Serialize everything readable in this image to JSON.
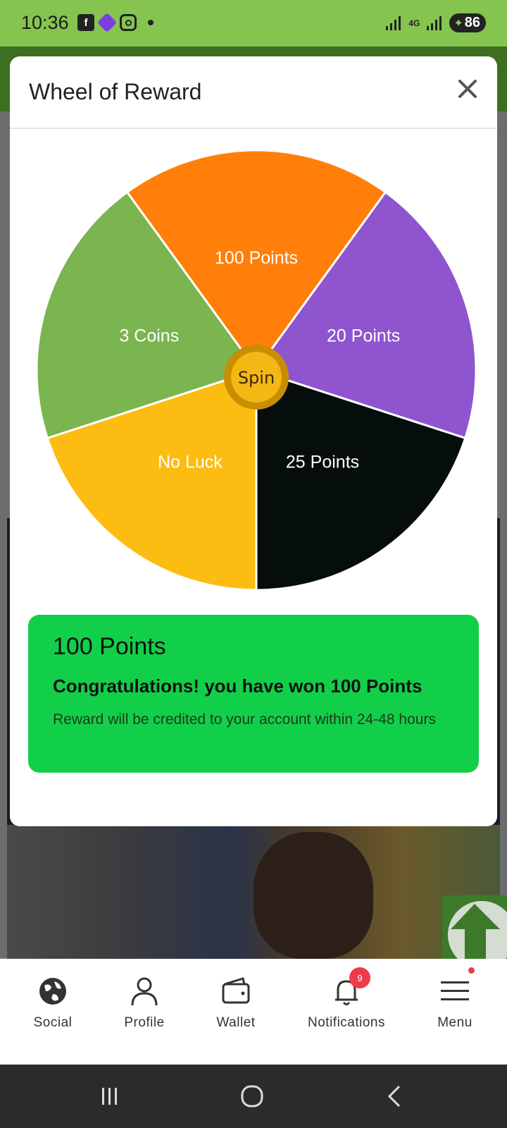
{
  "status_bar": {
    "time": "10:36",
    "network": "4G",
    "battery": "86",
    "notification_icons": [
      "facebook-icon",
      "app-icon",
      "instagram-icon"
    ]
  },
  "dialog": {
    "title": "Wheel of Reward",
    "close_icon": "close-icon",
    "spin_label": "Spin",
    "wheel_segments": [
      {
        "label": "100 Points",
        "color": "#FF7F0A"
      },
      {
        "label": "20 Points",
        "color": "#8F55CF"
      },
      {
        "label": "25 Points",
        "color": "#060D0D"
      },
      {
        "label": "No Luck",
        "color": "#FDBC12"
      },
      {
        "label": "3 Coins",
        "color": "#7AB54F"
      }
    ],
    "result": {
      "title": "100 Points",
      "message": "Congratulations! you have won 100 Points",
      "note": "Reward will be credited to your account within 24-48 hours",
      "color": "#12CF49"
    }
  },
  "bottom_nav": {
    "items": [
      {
        "label": "Social",
        "icon": "globe-icon"
      },
      {
        "label": "Profile",
        "icon": "user-icon"
      },
      {
        "label": "Wallet",
        "icon": "wallet-icon"
      },
      {
        "label": "Notifications",
        "icon": "bell-icon",
        "badge": "9"
      },
      {
        "label": "Menu",
        "icon": "hamburger-icon"
      }
    ]
  },
  "system_nav": [
    "recents-icon",
    "home-icon",
    "back-icon"
  ],
  "colors": {
    "status_bar": "#85C44F",
    "app_bar": "#3E6E22",
    "badge": "#EF3A4A",
    "spin_button": "#E7A90A"
  }
}
